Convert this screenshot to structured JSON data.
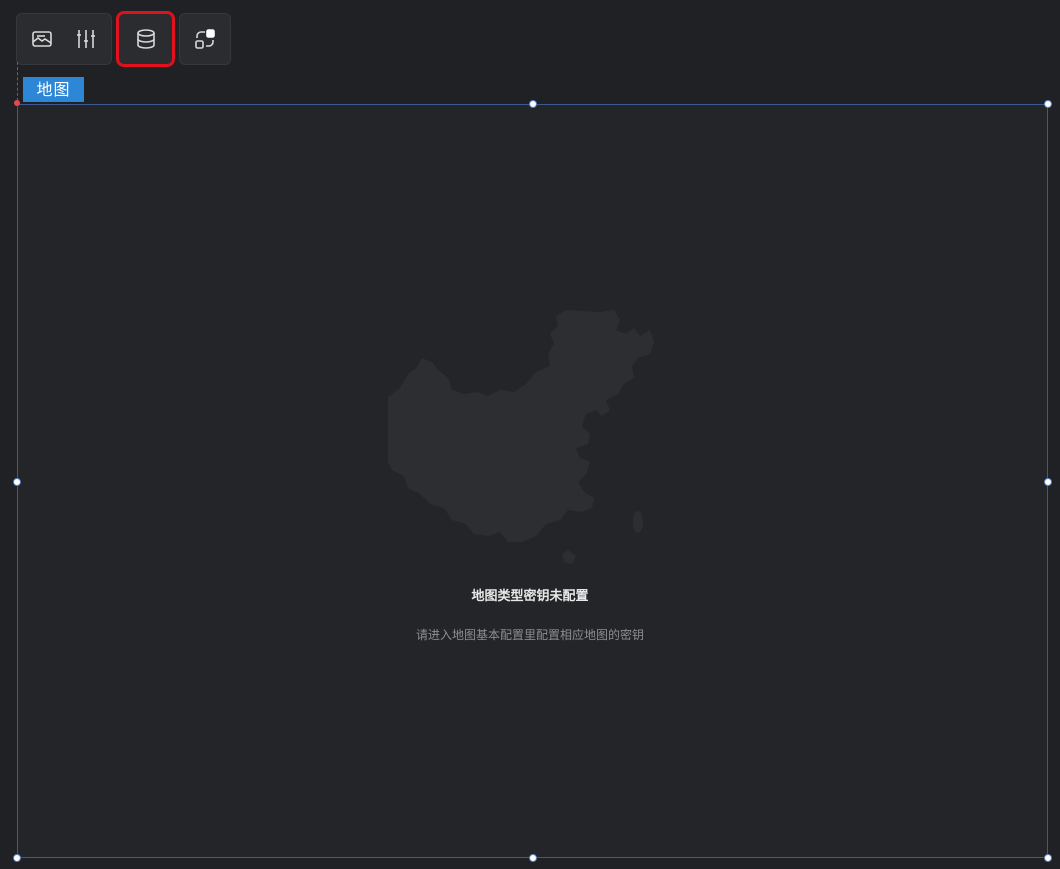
{
  "toolbar": {
    "buttons": [
      {
        "icon": "image-icon",
        "label": ""
      },
      {
        "icon": "sliders-icon",
        "label": ""
      },
      {
        "icon": "database-icon",
        "label": "",
        "selected": true
      },
      {
        "icon": "interaction-icon",
        "label": ""
      }
    ]
  },
  "component": {
    "tag_label": "地图"
  },
  "empty_state": {
    "title": "地图类型密钥未配置",
    "description": "请进入地图基本配置里配置相应地图的密钥",
    "graphic": "china-map-icon"
  },
  "colors": {
    "background": "#202124",
    "frame_border": "#3c5a91",
    "tag_bg": "#2e86d6",
    "selected_outline": "#e3101e"
  }
}
